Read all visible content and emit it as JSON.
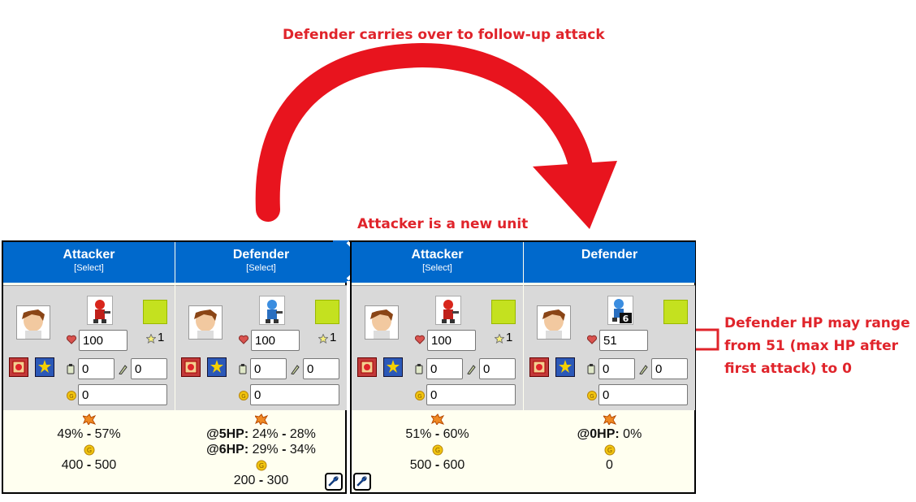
{
  "annotations": {
    "carry": "Defender carries over to follow-up attack",
    "new_unit": "Attacker is a new unit",
    "hp_range": "Defender HP may range from 51 (max HP after first attack) to 0"
  },
  "colors": {
    "header": "#0069cc",
    "annotation": "#e0242b",
    "terrain": "#c4e11f"
  },
  "calc1": {
    "attacker": {
      "title": "Attacker",
      "select": "[Select]",
      "hp": "100",
      "stars": "1",
      "fuel": "0",
      "ammo": "0",
      "funds": "0",
      "damage_line": {
        "lo": "49%",
        "sep": " - ",
        "hi": "57%"
      },
      "funds_line": {
        "lo": "400",
        "sep": " - ",
        "hi": "500"
      }
    },
    "defender": {
      "title": "Defender",
      "select": "[Select]",
      "hp": "100",
      "stars": "1",
      "fuel": "0",
      "ammo": "0",
      "funds": "0",
      "damage_lines": [
        {
          "at": "@5HP:",
          "lo": " 24%",
          "sep": " - ",
          "hi": "28%"
        },
        {
          "at": "@6HP:",
          "lo": " 29%",
          "sep": " - ",
          "hi": "34%"
        }
      ],
      "funds_line": {
        "lo": "200",
        "sep": " - ",
        "hi": "300"
      }
    }
  },
  "calc2": {
    "attacker": {
      "title": "Attacker",
      "select": "[Select]",
      "hp": "100",
      "stars": "1",
      "fuel": "0",
      "ammo": "0",
      "funds": "0",
      "damage_line": {
        "lo": "51%",
        "sep": " - ",
        "hi": "60%"
      },
      "funds_line": {
        "lo": "500",
        "sep": " - ",
        "hi": "600"
      }
    },
    "defender": {
      "title": "Defender",
      "hp": "51",
      "fuel": "0",
      "ammo": "0",
      "funds": "0",
      "sprite_badge": "6",
      "damage_line": {
        "at": "@0HP:",
        "rest": " 0%"
      },
      "funds_value": "0"
    }
  },
  "icons": [
    "heart-icon",
    "star-icon",
    "fuel-icon",
    "ammo-icon",
    "coin-icon",
    "explosion-icon",
    "wrench-icon",
    "co-power-icon",
    "co-super-power-icon"
  ]
}
